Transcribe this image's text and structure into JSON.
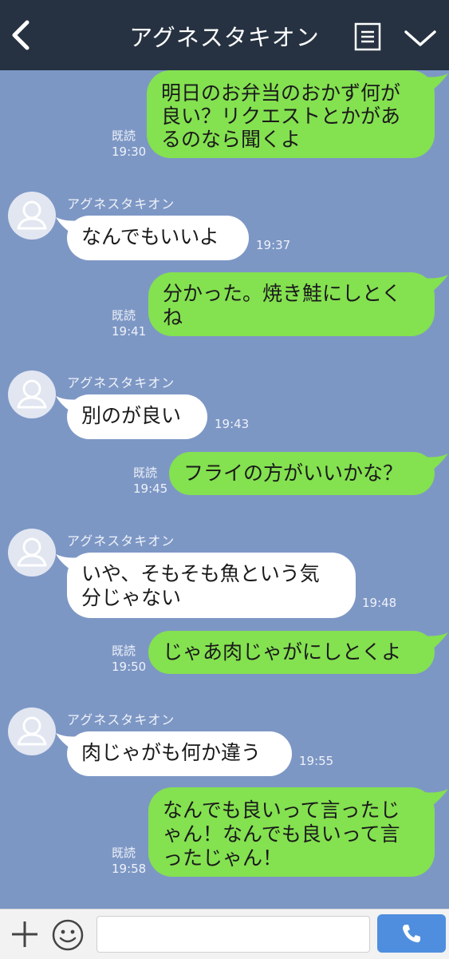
{
  "header": {
    "title": "アグネスタキオン"
  },
  "messages": [
    {
      "side": "out",
      "lines": [
        "明日のお弁当のおかず何が",
        "良い？リクエストとかがあ",
        "るのなら聞くよ"
      ],
      "read": "既読",
      "time": "19:30"
    },
    {
      "side": "in",
      "sender": "アグネスタキオン",
      "lines": [
        "なんでもいいよ"
      ],
      "time": "19:37"
    },
    {
      "side": "out",
      "lines": [
        "分かった。焼き鮭にしとく",
        "ね"
      ],
      "read": "既読",
      "time": "19:41"
    },
    {
      "side": "in",
      "sender": "アグネスタキオン",
      "lines": [
        "別のが良い"
      ],
      "time": "19:43"
    },
    {
      "side": "out",
      "lines": [
        "フライの方がいいかな？"
      ],
      "read": "既読",
      "time": "19:45"
    },
    {
      "side": "in",
      "sender": "アグネスタキオン",
      "lines": [
        "いや、そもそも魚という気",
        "分じゃない"
      ],
      "time": "19:48"
    },
    {
      "side": "out",
      "lines": [
        "じゃあ肉じゃがにしとくよ"
      ],
      "read": "既読",
      "time": "19:50"
    },
    {
      "side": "in",
      "sender": "アグネスタキオン",
      "lines": [
        "肉じゃがも何か違う"
      ],
      "time": "19:55"
    },
    {
      "side": "out",
      "lines": [
        "なんでも良いって言ったじ",
        "ゃん！なんでも良いって言",
        "ったじゃん！"
      ],
      "read": "既読",
      "time": "19:58"
    }
  ],
  "footer": {
    "input_placeholder": ""
  },
  "colors": {
    "background": "#7d97c5",
    "header": "#263241",
    "outgoing_bubble": "#84e150",
    "incoming_bubble": "#ffffff",
    "call_button": "#4f8ede"
  },
  "icons": {
    "back": "chevron-left-icon",
    "notes": "notes-icon",
    "menu": "chevron-down-icon",
    "plus": "plus-icon",
    "emoji": "emoji-icon",
    "call": "phone-icon",
    "avatar": "default-avatar-icon"
  }
}
